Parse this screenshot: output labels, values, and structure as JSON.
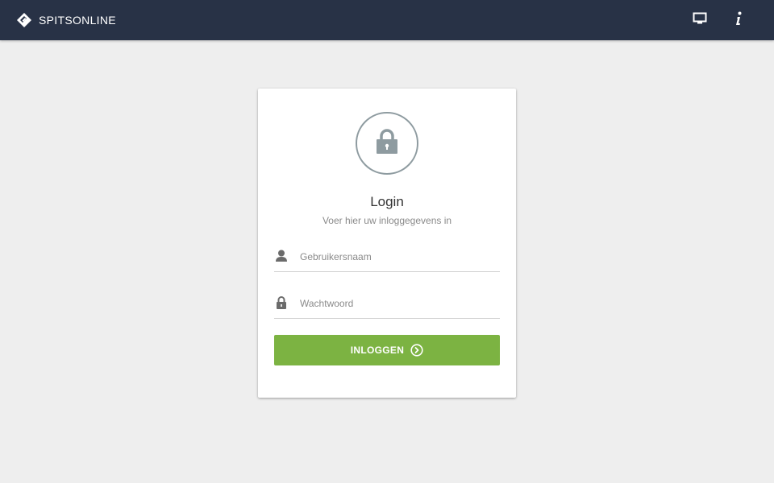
{
  "header": {
    "brand": {
      "prefix": "SPITS",
      "suffix": "ONLINE",
      "logo_icon": "spitsonline-logo-icon"
    },
    "actions": [
      {
        "icon": "monitor-icon"
      },
      {
        "icon": "info-icon"
      }
    ],
    "background_color": "#283246"
  },
  "login_card": {
    "lock_icon": "lock-icon",
    "title": "Login",
    "subtitle": "Voer hier uw inloggegevens in",
    "username": {
      "icon": "user-icon",
      "placeholder": "Gebruikersnaam",
      "value": ""
    },
    "password": {
      "icon": "lock-small-icon",
      "placeholder": "Wachtwoord",
      "value": ""
    },
    "submit": {
      "label": "INLOGGEN",
      "icon": "arrow-circle-right-icon",
      "color": "#7cb342"
    }
  }
}
